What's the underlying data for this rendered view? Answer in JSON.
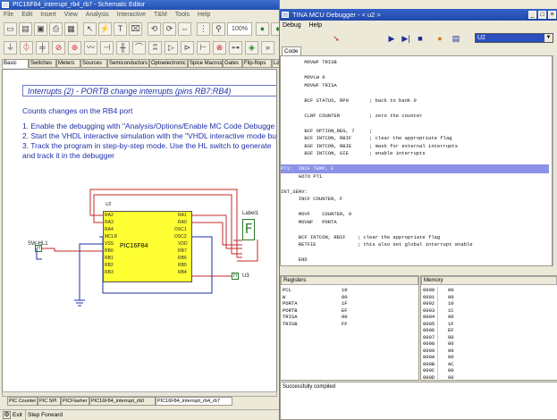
{
  "schematic": {
    "title": "PIC16F84_interrupt_rb4_rb7 - Schematic Editor",
    "menu": [
      "File",
      "Edit",
      "Insert",
      "View",
      "Analysis",
      "Interactive",
      "T&M",
      "Tools",
      "Help"
    ],
    "zoom": "100%",
    "component_tabs": [
      "Basic",
      "Switches",
      "Meters",
      "Sources",
      "Semiconductors",
      "Optoelectronic",
      "Spice Macros",
      "Gates",
      "Flip-flops",
      "Ld"
    ],
    "heading": "Interrupts (2) - PORTB change interrupts (pins RB7:RB4)",
    "lines": [
      "Counts changes on the RB4 port",
      "1. Enable the debugging with \"Analysis/Options/Enable MC Code Debugge",
      "2. Start the VHDL interactive simulation with the \"VHDL interactive mode bu",
      "3. Track the program in step-by-step mode. Use the HL switch to generate",
      "and track it in the debugger"
    ],
    "chip_ref": "U2",
    "chip_name": "PIC16F84",
    "pins_left": [
      "RA2",
      "RA3",
      "RA4",
      "MCLR",
      "VSS",
      "RB0",
      "RB1",
      "RB2",
      "RB3"
    ],
    "pins_right": [
      "RA1",
      "RA0",
      "OSC1",
      "OSC2",
      "VDD",
      "RB7",
      "RB6",
      "RB5",
      "RB4"
    ],
    "display_label": "Label1",
    "display_value": "F",
    "switch_label": "SW-HL1",
    "switch_state": "H",
    "probe_label": "U3",
    "probe_state": "H",
    "bottom_tabs": [
      "PIC Counter",
      "PIC SPI",
      "PICFlasher",
      "PIC16F84_interrupt_rb0",
      "PIC16F84_interrupt_rb4_rb7"
    ],
    "status_items": [
      "Exit",
      "Step Forward"
    ]
  },
  "debugger": {
    "title": "TINA MCU Debugger - < u2 >",
    "menu": [
      "Debug",
      "Help"
    ],
    "device": "U2",
    "code_tab": "Code",
    "code_lines": [
      {
        "text": "        MOVWF TRISB",
        "hl": false
      },
      {
        "text": "",
        "hl": false
      },
      {
        "text": "        MOVLW 0",
        "hl": false
      },
      {
        "text": "        MOVWF TRISA",
        "hl": false
      },
      {
        "text": "",
        "hl": false
      },
      {
        "text": "        BCF STATUS, RP0       ; back to bank 0",
        "hl": false
      },
      {
        "text": "",
        "hl": false
      },
      {
        "text": "        CLRF COUNTER          ; zero the counter",
        "hl": false
      },
      {
        "text": "",
        "hl": false
      },
      {
        "text": "        BCF OPTION_REG, 7     ;",
        "hl": false
      },
      {
        "text": "        BCF INTCON, RBIF      ; clear the appropriate flag",
        "hl": false
      },
      {
        "text": "        BSF INTCON, RBIE      ; mask for external interrupts",
        "hl": false
      },
      {
        "text": "        BSF INTCON, GIE       ; enable interrupts",
        "hl": false
      },
      {
        "text": "",
        "hl": false
      },
      {
        "text": "PT1:  INCF TEMP, F",
        "hl": true
      },
      {
        "text": "      GOTO PT1",
        "hl": false
      },
      {
        "text": "",
        "hl": false
      },
      {
        "text": "INT_SERV:",
        "hl": false
      },
      {
        "text": "      INCF COUNTER, F",
        "hl": false
      },
      {
        "text": "",
        "hl": false
      },
      {
        "text": "      MOVF    COUNTER, 0",
        "hl": false
      },
      {
        "text": "      MOVWF   PORTA",
        "hl": false
      },
      {
        "text": "",
        "hl": false
      },
      {
        "text": "      BCF INTCON, RBIF    ; clear the appropriate flag",
        "hl": false
      },
      {
        "text": "      RETFIE              ; this also set global interrupt enable",
        "hl": false
      },
      {
        "text": "",
        "hl": false
      },
      {
        "text": "      END",
        "hl": false
      }
    ],
    "registers_header": "Registers",
    "registers": [
      {
        "name": "PCL",
        "value": "10"
      },
      {
        "name": "W",
        "value": "00"
      },
      {
        "name": "PORTA",
        "value": "1F"
      },
      {
        "name": "PORTB",
        "value": "EF"
      },
      {
        "name": "TRISA",
        "value": "00"
      },
      {
        "name": "TRISB",
        "value": "FF"
      }
    ],
    "memory_header": "Memory",
    "memory": [
      {
        "addr": "0000",
        "value": "00"
      },
      {
        "addr": "0001",
        "value": "00"
      },
      {
        "addr": "0002",
        "value": "10"
      },
      {
        "addr": "0003",
        "value": "1C"
      },
      {
        "addr": "0004",
        "value": "00"
      },
      {
        "addr": "0005",
        "value": "1F"
      },
      {
        "addr": "0006",
        "value": "EF"
      },
      {
        "addr": "0007",
        "value": "00"
      },
      {
        "addr": "0008",
        "value": "00"
      },
      {
        "addr": "0009",
        "value": "00"
      },
      {
        "addr": "000A",
        "value": "00"
      },
      {
        "addr": "000B",
        "value": "AC"
      },
      {
        "addr": "000C",
        "value": "00"
      },
      {
        "addr": "000D",
        "value": "00"
      }
    ],
    "log": "Successfully compiled"
  },
  "colors": {
    "chip_fill": "#ffff33",
    "wire": "#c62828",
    "title_blue": "#244fb0",
    "highlight": "#8c93e6",
    "doc_text": "#1e2fa8"
  }
}
